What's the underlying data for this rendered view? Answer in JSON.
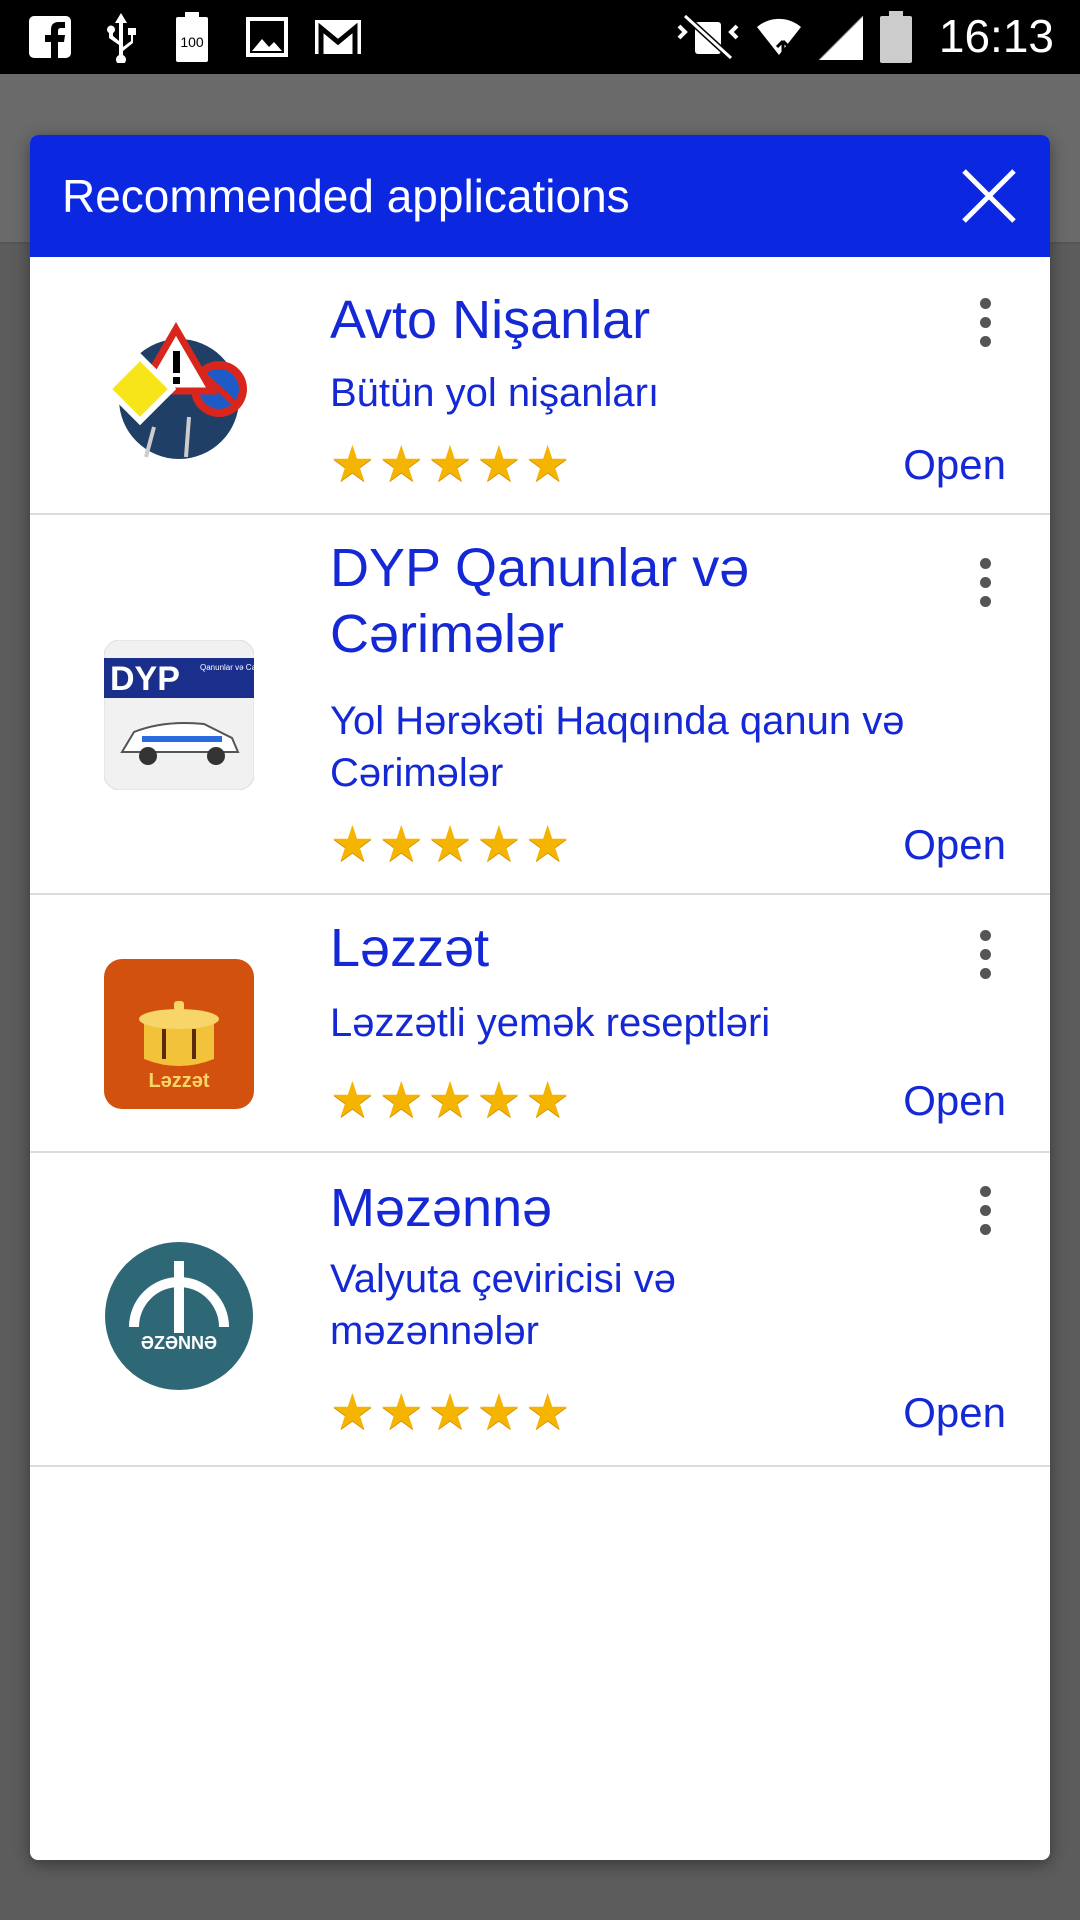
{
  "status_bar": {
    "time": "16:13",
    "battery_text": "100",
    "icons": [
      "facebook-icon",
      "usb-icon",
      "battery-full-icon",
      "gallery-icon",
      "gmail-icon",
      "mute-icon",
      "wifi-icon",
      "signal-icon",
      "battery-icon"
    ]
  },
  "dialog": {
    "title": "Recommended applications",
    "header_color": "#0b28e0",
    "text_color": "#1428d6",
    "star_color": "#f5b400"
  },
  "apps": [
    {
      "name": "Avto Nişanlar",
      "description": "Bütün yol nişanları",
      "stars": "★★★★★",
      "open_label": "Open",
      "icon": "road-signs-icon"
    },
    {
      "name": "DYP Qanunlar və Cərimələr",
      "description": "Yol Hərəkəti Haqqında qanun və Cərimələr",
      "stars": "★★★★★",
      "open_label": "Open",
      "icon": "dyp-police-car-icon",
      "icon_text": "DYP",
      "icon_subtext": "Qanunlar və Cərimələr"
    },
    {
      "name": "Ləzzət",
      "description": "Ləzzətli yemək reseptləri",
      "stars": "★★★★★",
      "open_label": "Open",
      "icon": "cooking-pot-icon",
      "icon_text": "Ləzzət"
    },
    {
      "name": "Məzənnə",
      "description": "Valyuta çeviricisi və məzənnələr",
      "stars": "★★★★★",
      "open_label": "Open",
      "icon": "manat-currency-icon",
      "icon_text": "ƏZƏNNƏ"
    }
  ]
}
